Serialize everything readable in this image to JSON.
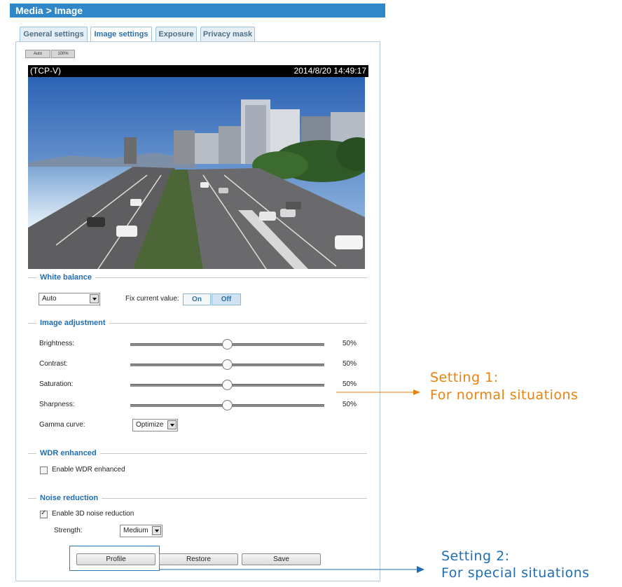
{
  "header": {
    "title": "Media > Image"
  },
  "tabs": [
    {
      "label": "General settings"
    },
    {
      "label": "Image settings"
    },
    {
      "label": "Exposure"
    },
    {
      "label": "Privacy mask"
    }
  ],
  "view_modes": [
    {
      "label": "Auto"
    },
    {
      "label": "100%"
    }
  ],
  "video": {
    "stream": "(TCP-V)",
    "timestamp": "2014/8/20 14:49:17"
  },
  "white_balance": {
    "title": "White balance",
    "mode_value": "Auto",
    "fix_label": "Fix current value:",
    "on_label": "On",
    "off_label": "Off"
  },
  "image_adjustment": {
    "title": "Image adjustment",
    "sliders": [
      {
        "label": "Brightness:",
        "value_text": "50%",
        "value": 0.5
      },
      {
        "label": "Contrast:",
        "value_text": "50%",
        "value": 0.5
      },
      {
        "label": "Saturation:",
        "value_text": "50%",
        "value": 0.5
      },
      {
        "label": "Sharpness:",
        "value_text": "50%",
        "value": 0.5
      }
    ],
    "gamma_label": "Gamma curve:",
    "gamma_value": "Optimize"
  },
  "wdr": {
    "title": "WDR enhanced",
    "checkbox_label": "Enable WDR enhanced",
    "checked": false
  },
  "noise": {
    "title": "Noise reduction",
    "checkbox_label": "Enable 3D noise reduction",
    "checked": true,
    "strength_label": "Strength:",
    "strength_value": "Medium"
  },
  "buttons": {
    "profile": "Profile",
    "restore": "Restore",
    "save": "Save"
  },
  "annotations": {
    "setting1_line1": "Setting 1:",
    "setting1_line2": "For normal situations",
    "setting2_line1": "Setting 2:",
    "setting2_line2": "For special situations"
  },
  "colors": {
    "accent": "#2f86c8",
    "section_title": "#1f6db4",
    "annotation1": "#e8820e",
    "annotation2": "#1f6db4"
  }
}
